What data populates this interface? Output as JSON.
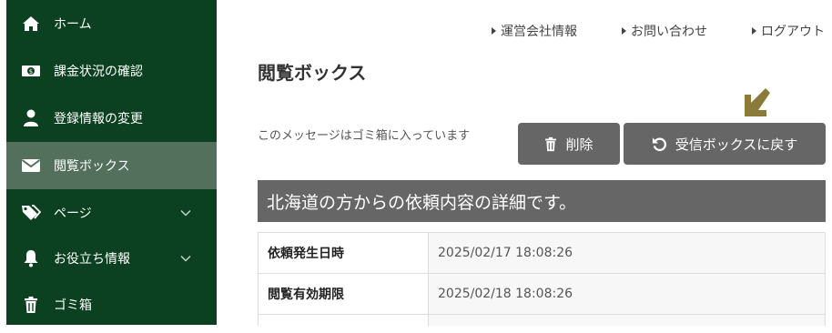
{
  "sidebar": {
    "items": [
      {
        "label": "ホーム",
        "icon": "home-icon"
      },
      {
        "label": "課金状況の確認",
        "icon": "money-icon"
      },
      {
        "label": "登録情報の変更",
        "icon": "user-icon"
      },
      {
        "label": "閲覧ボックス",
        "icon": "envelope-icon",
        "active": true
      },
      {
        "label": "ページ",
        "icon": "tags-icon",
        "expandable": true
      },
      {
        "label": "お役立ち情報",
        "icon": "bell-icon",
        "expandable": true
      },
      {
        "label": "ゴミ箱",
        "icon": "trash-icon"
      }
    ]
  },
  "header": {
    "links": [
      "運営会社情報",
      "お問い合わせ",
      "ログアウト"
    ]
  },
  "main": {
    "title": "閲覧ボックス",
    "trash_message": "このメッセージはゴミ箱に入っています",
    "delete_label": "削除",
    "restore_label": "受信ボックスに戻す",
    "detail_title": "北海道の方からの依頼内容の詳細です。",
    "details": [
      {
        "key": "依頼発生日時",
        "value": "2025/02/17 18:08:26"
      },
      {
        "key": "閲覧有効期限",
        "value": "2025/02/18 18:08:26"
      }
    ]
  },
  "colors": {
    "sidebar_bg": "#0b4120",
    "sidebar_active": "#53705d",
    "button_bg": "#666666",
    "arrow_hint": "#8b7a3a"
  }
}
